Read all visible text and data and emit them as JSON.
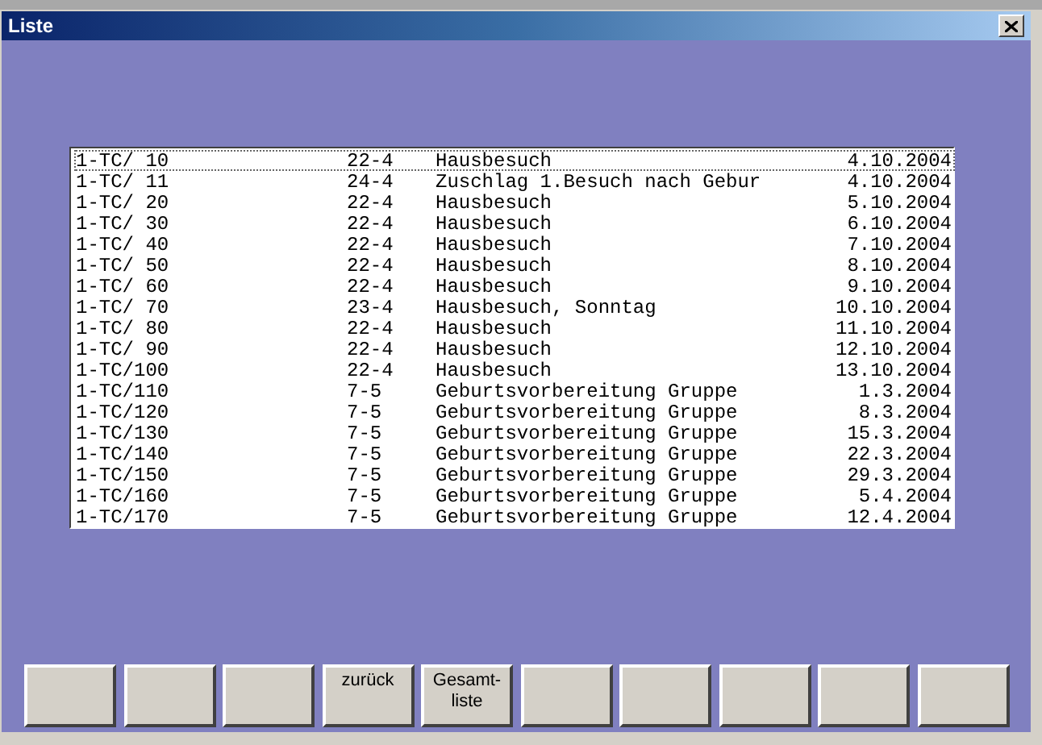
{
  "window": {
    "title": "Liste"
  },
  "list": {
    "rows": [
      {
        "id": "1-TC/ 10",
        "code": "22-4",
        "text": "Hausbesuch",
        "date": "4.10.2004",
        "selected": true
      },
      {
        "id": "1-TC/ 11",
        "code": "24-4",
        "text": "Zuschlag 1.Besuch nach Gebur",
        "date": "4.10.2004",
        "selected": false
      },
      {
        "id": "1-TC/ 20",
        "code": "22-4",
        "text": "Hausbesuch",
        "date": "5.10.2004",
        "selected": false
      },
      {
        "id": "1-TC/ 30",
        "code": "22-4",
        "text": "Hausbesuch",
        "date": "6.10.2004",
        "selected": false
      },
      {
        "id": "1-TC/ 40",
        "code": "22-4",
        "text": "Hausbesuch",
        "date": "7.10.2004",
        "selected": false
      },
      {
        "id": "1-TC/ 50",
        "code": "22-4",
        "text": "Hausbesuch",
        "date": "8.10.2004",
        "selected": false
      },
      {
        "id": "1-TC/ 60",
        "code": "22-4",
        "text": "Hausbesuch",
        "date": "9.10.2004",
        "selected": false
      },
      {
        "id": "1-TC/ 70",
        "code": "23-4",
        "text": "Hausbesuch, Sonntag",
        "date": "10.10.2004",
        "selected": false
      },
      {
        "id": "1-TC/ 80",
        "code": "22-4",
        "text": "Hausbesuch",
        "date": "11.10.2004",
        "selected": false
      },
      {
        "id": "1-TC/ 90",
        "code": "22-4",
        "text": "Hausbesuch",
        "date": "12.10.2004",
        "selected": false
      },
      {
        "id": "1-TC/100",
        "code": "22-4",
        "text": "Hausbesuch",
        "date": "13.10.2004",
        "selected": false
      },
      {
        "id": "1-TC/110",
        "code": "7-5",
        "text": "Geburtsvorbereitung Gruppe",
        "date": "1.3.2004",
        "selected": false
      },
      {
        "id": "1-TC/120",
        "code": "7-5",
        "text": "Geburtsvorbereitung Gruppe",
        "date": "8.3.2004",
        "selected": false
      },
      {
        "id": "1-TC/130",
        "code": "7-5",
        "text": "Geburtsvorbereitung Gruppe",
        "date": "15.3.2004",
        "selected": false
      },
      {
        "id": "1-TC/140",
        "code": "7-5",
        "text": "Geburtsvorbereitung Gruppe",
        "date": "22.3.2004",
        "selected": false
      },
      {
        "id": "1-TC/150",
        "code": "7-5",
        "text": "Geburtsvorbereitung Gruppe",
        "date": "29.3.2004",
        "selected": false
      },
      {
        "id": "1-TC/160",
        "code": "7-5",
        "text": "Geburtsvorbereitung Gruppe",
        "date": "5.4.2004",
        "selected": false
      },
      {
        "id": "1-TC/170",
        "code": "7-5",
        "text": "Geburtsvorbereitung Gruppe",
        "date": "12.4.2004",
        "selected": false
      }
    ]
  },
  "buttons": [
    {
      "kind": "blank"
    },
    {
      "kind": "blank"
    },
    {
      "kind": "blank"
    },
    {
      "kind": "label",
      "label": "zurück"
    },
    {
      "kind": "label",
      "label": "Gesamt-liste"
    },
    {
      "kind": "blank"
    },
    {
      "kind": "blank"
    },
    {
      "kind": "blank"
    },
    {
      "kind": "blank"
    },
    {
      "kind": "blank"
    }
  ]
}
